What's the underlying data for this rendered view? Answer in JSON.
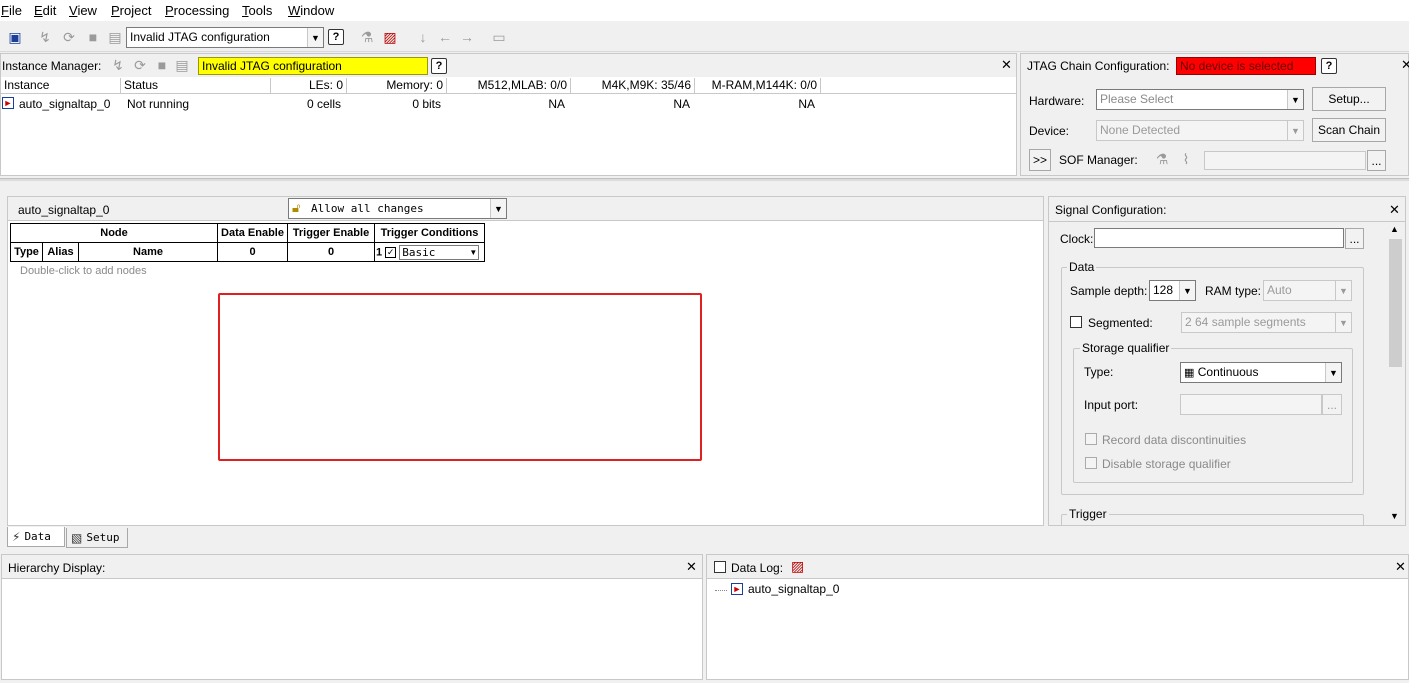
{
  "menu": [
    "File",
    "Edit",
    "View",
    "Project",
    "Processing",
    "Tools",
    "Window"
  ],
  "toolbar": {
    "jtag_combo": "Invalid JTAG configuration"
  },
  "instance_manager": {
    "label": "Instance Manager:",
    "status": "Invalid JTAG configuration",
    "status_color": "#ffff00",
    "columns": [
      "Instance",
      "Status",
      "LEs: 0",
      "Memory: 0",
      "M512,MLAB: 0/0",
      "M4K,M9K: 35/46",
      "M-RAM,M144K: 0/0"
    ],
    "rows": [
      {
        "instance": "auto_signaltap_0",
        "status": "Not running",
        "les": "0 cells",
        "memory": "0 bits",
        "m512": "NA",
        "m4k": "NA",
        "mram": "NA"
      }
    ]
  },
  "jtag": {
    "label": "JTAG Chain Configuration:",
    "status": "No device is selected",
    "status_color": "#ff0000",
    "hardware_label": "Hardware:",
    "hardware_value": "Please Select",
    "setup_button": "Setup...",
    "device_label": "Device:",
    "device_value": "None Detected",
    "scan_button": "Scan Chain",
    "expand_button": ">>",
    "sof_label": "SOF Manager:",
    "browse_button": "..."
  },
  "editor": {
    "instance_name": "auto_signaltap_0",
    "lock_mode": "Allow all changes",
    "headers_top": [
      "Node",
      "Data Enable",
      "Trigger Enable",
      "Trigger Conditions"
    ],
    "headers_bottom": [
      "Type",
      "Alias",
      "Name",
      "0",
      "0",
      "1"
    ],
    "trigger_select": "Basic",
    "hint": "Double-click to add nodes",
    "highlight_color": "#e02020"
  },
  "signal_config": {
    "title": "Signal Configuration:",
    "clock_label": "Clock:",
    "browse": "...",
    "data_group": "Data",
    "sample_depth_label": "Sample depth:",
    "sample_depth": "128",
    "ram_type_label": "RAM type:",
    "ram_type": "Auto",
    "segmented_label": "Segmented:",
    "segments": "2  64 sample segments",
    "storage_group": "Storage qualifier",
    "type_label": "Type:",
    "type_value": "Continuous",
    "input_port_label": "Input port:",
    "record_label": "Record data discontinuities",
    "disable_label": "Disable storage qualifier",
    "trigger_group": "Trigger"
  },
  "tabs": {
    "data": "Data",
    "setup": "Setup"
  },
  "hierarchy": {
    "title": "Hierarchy Display:"
  },
  "datalog": {
    "label": "Data Log:",
    "item": "auto_signaltap_0"
  }
}
